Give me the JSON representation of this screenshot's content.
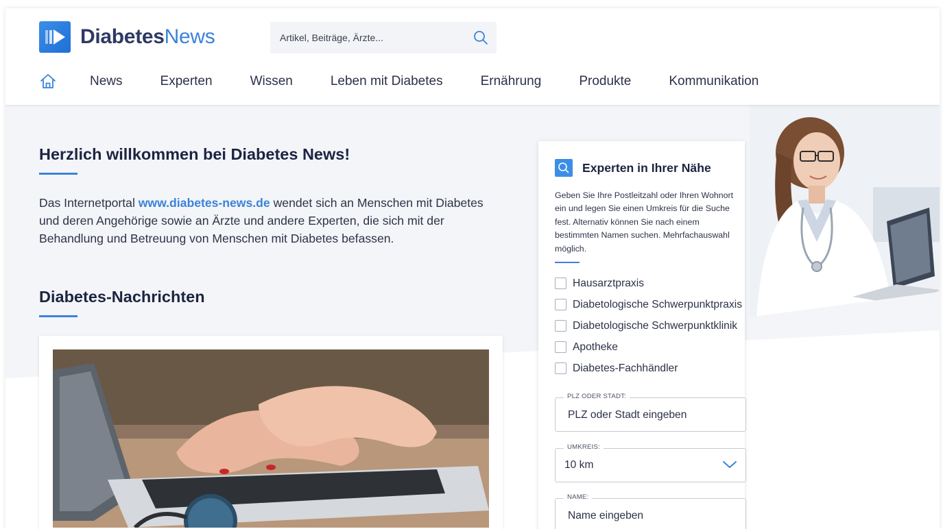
{
  "brand": {
    "name_part1": "Diabetes",
    "name_part2": "News",
    "accent_color": "#3b82d9"
  },
  "search": {
    "placeholder": "Artikel, Beiträge, Ärzte...",
    "icon": "search-icon"
  },
  "nav": {
    "home_icon": "home-icon",
    "items": [
      "News",
      "Experten",
      "Wissen",
      "Leben mit Diabetes",
      "Ernährung",
      "Produkte",
      "Kommunikation"
    ]
  },
  "main": {
    "welcome_title": "Herzlich willkommen bei Diabetes News!",
    "intro_prefix": "Das Internetportal ",
    "intro_link": "www.diabetes-news.de",
    "intro_suffix": " wendet sich an Menschen mit Diabetes und deren Angehörige sowie an Ärzte und andere Experten, die sich mit der Behandlung und Betreuung von Menschen mit Diabetes befassen.",
    "news_title": "Diabetes-Nachrichten"
  },
  "experts": {
    "title": "Experten in Ihrer Nähe",
    "description": "Geben Sie Ihre Postleitzahl oder Ihren Wohnort ein und legen Sie einen Umkreis für die Suche fest. Alternativ können Sie nach einem bestimmten Namen suchen. Mehrfachauswahl möglich.",
    "checkboxes": [
      "Hausarztpraxis",
      "Diabetologische Schwerpunktpraxis",
      "Diabetologische Schwerpunktklinik",
      "Apotheke",
      "Diabetes-Fachhändler"
    ],
    "plz_label": "PLZ ODER STADT:",
    "plz_placeholder": "PLZ oder Stadt eingeben",
    "radius_label": "UMKREIS:",
    "radius_value": "10 km",
    "name_label": "NAME:",
    "name_placeholder": "Name eingeben"
  }
}
